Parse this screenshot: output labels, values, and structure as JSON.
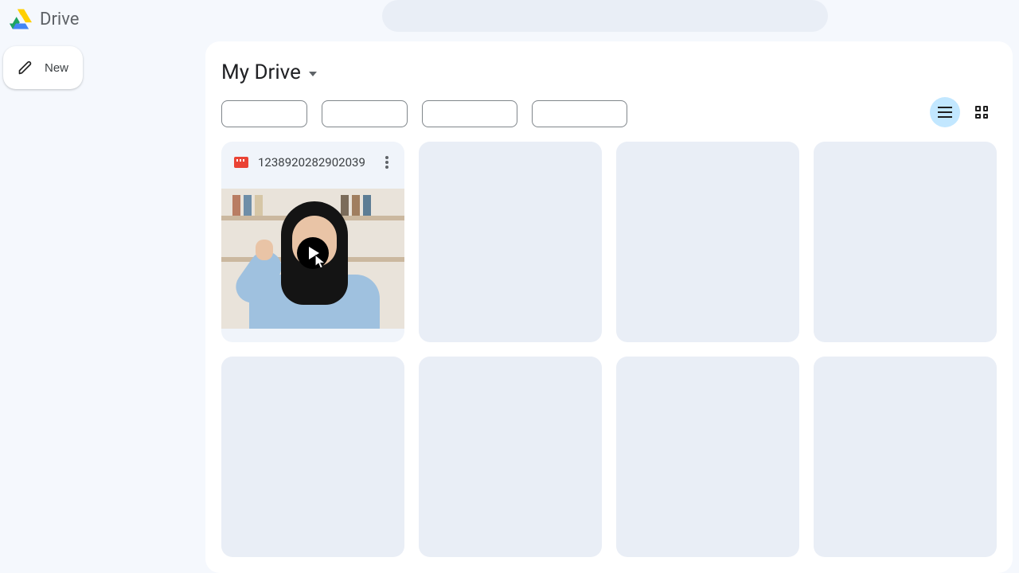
{
  "app": {
    "name": "Drive"
  },
  "sidebar": {
    "new_label": "New"
  },
  "breadcrumb": {
    "title": "My Drive"
  },
  "files": [
    {
      "name": "1238920282902039",
      "type": "video"
    }
  ]
}
